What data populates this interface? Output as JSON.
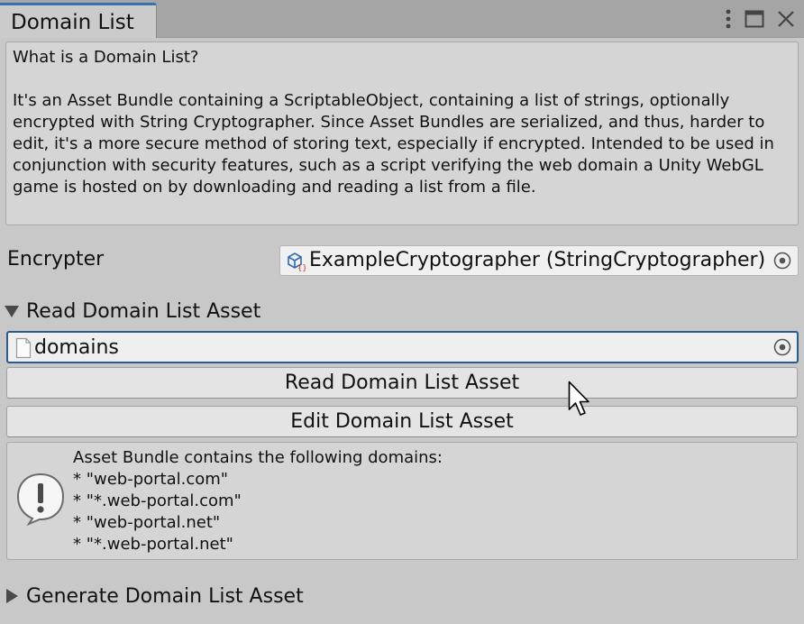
{
  "window": {
    "tab_title": "Domain List",
    "controls": [
      "kebab-menu-icon",
      "maximize-icon",
      "close-icon"
    ]
  },
  "help": {
    "question": "What is a Domain List?",
    "body": "It's an Asset Bundle containing a ScriptableObject, containing a list of strings, optionally encrypted with String Cryptographer. Since Asset Bundles are serialized, and thus, harder to edit, it's a more secure method of storing text, especially if encrypted. Intended to be used in conjunction with security features, such as a script verifying the web domain a Unity WebGL game is hosted on by downloading and reading a list from a file."
  },
  "encrypter": {
    "label": "Encrypter",
    "value": "ExampleCryptographer (StringCryptographer)",
    "icon": "scriptable-object-icon"
  },
  "read_section": {
    "title": "Read Domain List Asset",
    "expanded": true,
    "asset_value": "domains",
    "read_button": "Read Domain List Asset",
    "edit_button": "Edit Domain List Asset"
  },
  "info": {
    "icon": "warning-icon",
    "heading": "Asset Bundle contains the following domains:",
    "domains": [
      "* \"web-portal.com\"",
      "* \"*.web-portal.com\"",
      "* \"web-portal.net\"",
      "* \"*.web-portal.net\""
    ]
  },
  "generate_section": {
    "title": "Generate Domain List Asset",
    "expanded": false
  },
  "colors": {
    "background": "#c8c8c8",
    "titlebar": "#a5a5a5",
    "accent": "#3a72b0",
    "focus_border": "#2c5a92"
  }
}
